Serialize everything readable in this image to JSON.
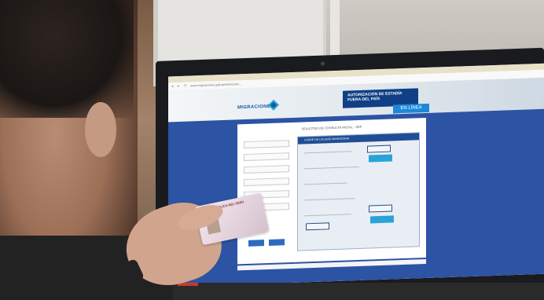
{
  "browser": {
    "url_text": "www.migraciones.gob.pe/servicios/..."
  },
  "site": {
    "logo_text": "MIGRACIONES",
    "banner_line1": "AUTORIZACIÓN DE ESTADÍA",
    "banner_line2": "FUERA DEL PAÍS",
    "banner_sub": "EN LÍNEA",
    "form_title": "SOLICITUD DE CONSULTA INICIAL - SEF",
    "mock_header": "CARNÉ DE CALIDAD MIGRATORIA"
  },
  "id_card": {
    "header": "REPÚBLICA DEL PERÚ"
  },
  "colors": {
    "site_blue": "#2d53a4",
    "banner_blue": "#0f3f85",
    "accent_blue": "#1e88d6"
  }
}
